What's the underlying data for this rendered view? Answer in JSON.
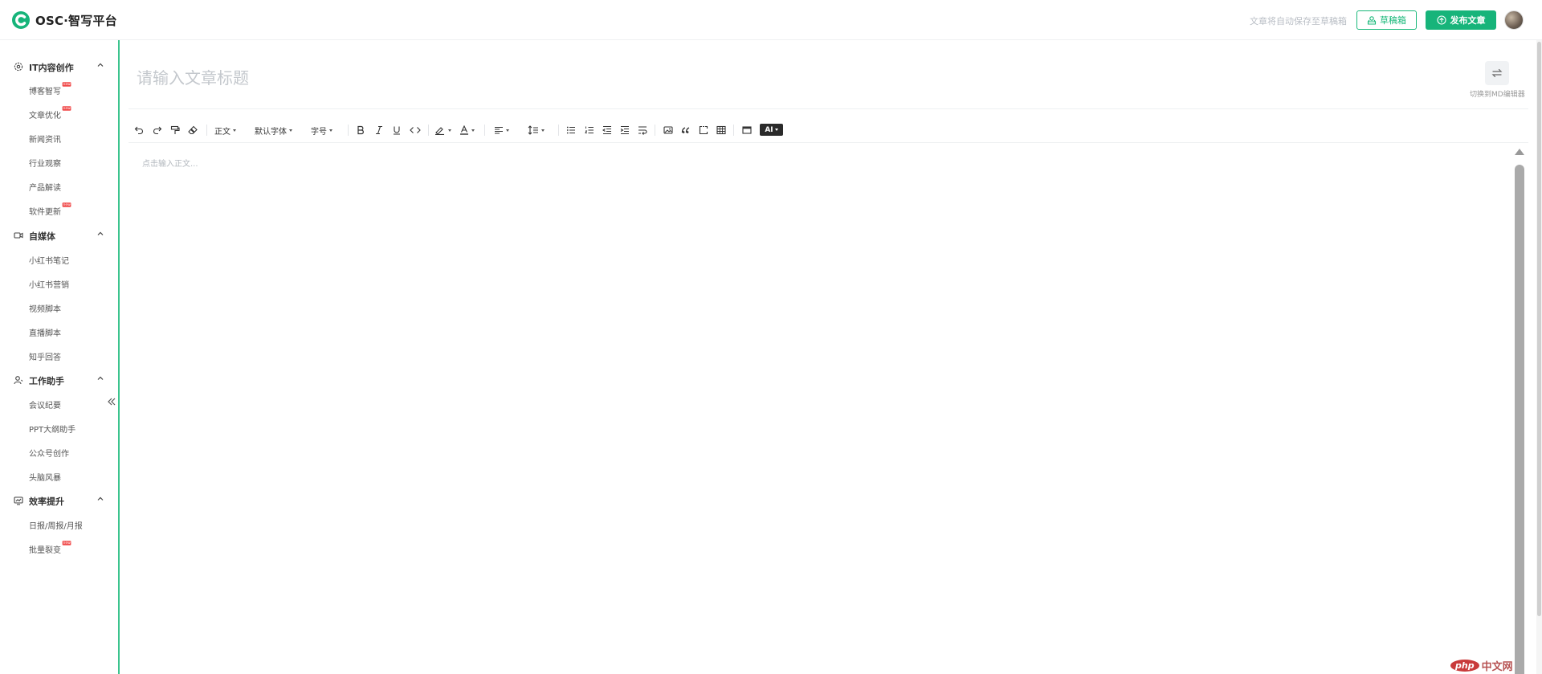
{
  "app": {
    "brand_name": "OSC·智写平台",
    "autosave_notice": "文章将自动保存至草稿箱",
    "drafts_label": "草稿箱",
    "publish_label": "发布文章",
    "brand_color": "#17b47a"
  },
  "sidebar": {
    "new_badge": "new",
    "groups": [
      {
        "title": "IT内容创作",
        "icon": "gear-icon",
        "items": [
          {
            "label": "博客智写",
            "new": true
          },
          {
            "label": "文章优化",
            "new": true
          },
          {
            "label": "新闻资讯",
            "new": false
          },
          {
            "label": "行业观察",
            "new": false
          },
          {
            "label": "产品解读",
            "new": false
          },
          {
            "label": "软件更新",
            "new": true
          }
        ]
      },
      {
        "title": "自媒体",
        "icon": "video-camera-icon",
        "items": [
          {
            "label": "小红书笔记",
            "new": false
          },
          {
            "label": "小红书营销",
            "new": false
          },
          {
            "label": "视频脚本",
            "new": false
          },
          {
            "label": "直播脚本",
            "new": false
          },
          {
            "label": "知乎回答",
            "new": false
          }
        ]
      },
      {
        "title": "工作助手",
        "icon": "user-assistant-icon",
        "items": [
          {
            "label": "会议纪要",
            "new": false
          },
          {
            "label": "PPT大纲助手",
            "new": false
          },
          {
            "label": "公众号创作",
            "new": false
          },
          {
            "label": "头脑风暴",
            "new": false
          }
        ]
      },
      {
        "title": "效率提升",
        "icon": "efficiency-icon",
        "items": [
          {
            "label": "日报/周报/月报",
            "new": false
          },
          {
            "label": "批量裂变",
            "new": true
          }
        ]
      }
    ]
  },
  "editor": {
    "title_placeholder": "请输入文章标题",
    "body_placeholder": "点击输入正文...",
    "switch_md_label": "切换到MD编辑器",
    "toolbar": {
      "paragraph": "正文",
      "font_family": "默认字体",
      "font_size": "字号",
      "ai": "AI"
    }
  },
  "watermark": {
    "logo": "php",
    "text": "中文网"
  }
}
